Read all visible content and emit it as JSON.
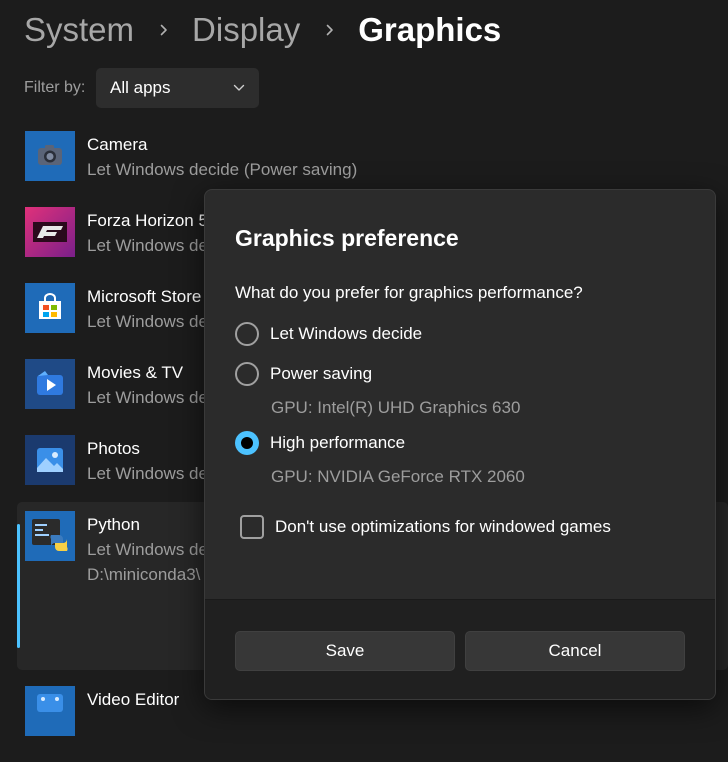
{
  "breadcrumb": {
    "items": [
      "System",
      "Display",
      "Graphics"
    ]
  },
  "filter": {
    "label": "Filter by:",
    "value": "All apps"
  },
  "apps": [
    {
      "name": "Camera",
      "status": "Let Windows decide (Power saving)",
      "icon": "camera-icon"
    },
    {
      "name": "Forza Horizon 5",
      "status": "Let Windows decide",
      "icon": "forza-icon"
    },
    {
      "name": "Microsoft Store",
      "status": "Let Windows decide",
      "icon": "store-icon"
    },
    {
      "name": "Movies & TV",
      "status": "Let Windows decide",
      "icon": "movies-icon"
    },
    {
      "name": "Photos",
      "status": "Let Windows decide",
      "icon": "photos-icon"
    },
    {
      "name": "Python",
      "status": "Let Windows decide",
      "path": "D:\\miniconda3\\",
      "icon": "python-icon"
    },
    {
      "name": "Video Editor",
      "status": "",
      "icon": "video-editor-icon"
    }
  ],
  "dialog": {
    "title": "Graphics preference",
    "question": "What do you prefer for graphics performance?",
    "options": [
      {
        "label": "Let Windows decide",
        "checked": false
      },
      {
        "label": "Power saving",
        "gpu": "GPU: Intel(R) UHD Graphics 630",
        "checked": false
      },
      {
        "label": "High performance",
        "gpu": "GPU: NVIDIA GeForce RTX 2060",
        "checked": true
      }
    ],
    "checkbox_label": "Don't use optimizations for windowed games",
    "save_label": "Save",
    "cancel_label": "Cancel"
  },
  "colors": {
    "accent": "#4cc2ff",
    "background": "#1c1c1c",
    "dialog": "#2b2b2b"
  }
}
